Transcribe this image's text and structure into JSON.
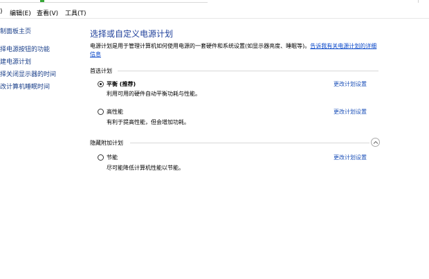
{
  "menu": {
    "partial_view": ")",
    "edit": "编辑(E)",
    "view": "查看(V)",
    "tools": "工具(T)"
  },
  "sidebar": {
    "items": [
      {
        "label": "制面板主页"
      },
      {
        "label": "择电源按钮的功能"
      },
      {
        "label": "建电源计划"
      },
      {
        "label": "择关闭显示器的时间"
      },
      {
        "label": "改计算机睡眠时间"
      }
    ]
  },
  "main": {
    "title": "选择或自定义电源计划",
    "description": "电源计划是用于管理计算机如何使用电源的一套硬件和系统设置(如显示器亮度、睡眠等)。",
    "learn_more_link": "告诉我有关电源计划的详细信息",
    "preferred_group_label": "首选计划",
    "hidden_group_label": "隐藏附加计划",
    "plans": [
      {
        "name": "平衡 (推荐)",
        "description": "利用可用的硬件自动平衡功耗与性能。",
        "change_label": "更改计划设置",
        "selected": true
      },
      {
        "name": "高性能",
        "description": "有利于提高性能，但会增加功耗。",
        "change_label": "更改计划设置",
        "selected": false
      },
      {
        "name": "节能",
        "description": "尽可能降低计算机性能以节能。",
        "change_label": "更改计划设置",
        "selected": false
      }
    ]
  },
  "colors": {
    "title": "#1e3f9a",
    "link": "#0645c8",
    "sidebar_link": "#1a3f8a"
  }
}
